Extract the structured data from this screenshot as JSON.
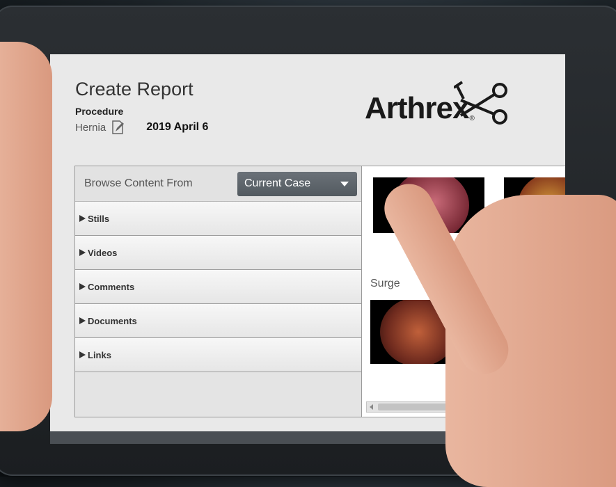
{
  "header": {
    "title": "Create Report",
    "procedure_label": "Procedure",
    "procedure_name": "Hernia",
    "procedure_date": "2019 April 6"
  },
  "logo": {
    "text": "Arthrex",
    "registered": "®"
  },
  "browse": {
    "label": "Browse Content From",
    "selected": "Current Case"
  },
  "sections": [
    {
      "label": "Stills"
    },
    {
      "label": "Videos"
    },
    {
      "label": "Comments"
    },
    {
      "label": "Documents"
    },
    {
      "label": "Links"
    }
  ],
  "gallery": {
    "section_label": "Surge"
  },
  "colors": {
    "dropdown": "#5c6369",
    "screen_bg": "#e9e9e9",
    "logo": "#1a1a1a"
  }
}
